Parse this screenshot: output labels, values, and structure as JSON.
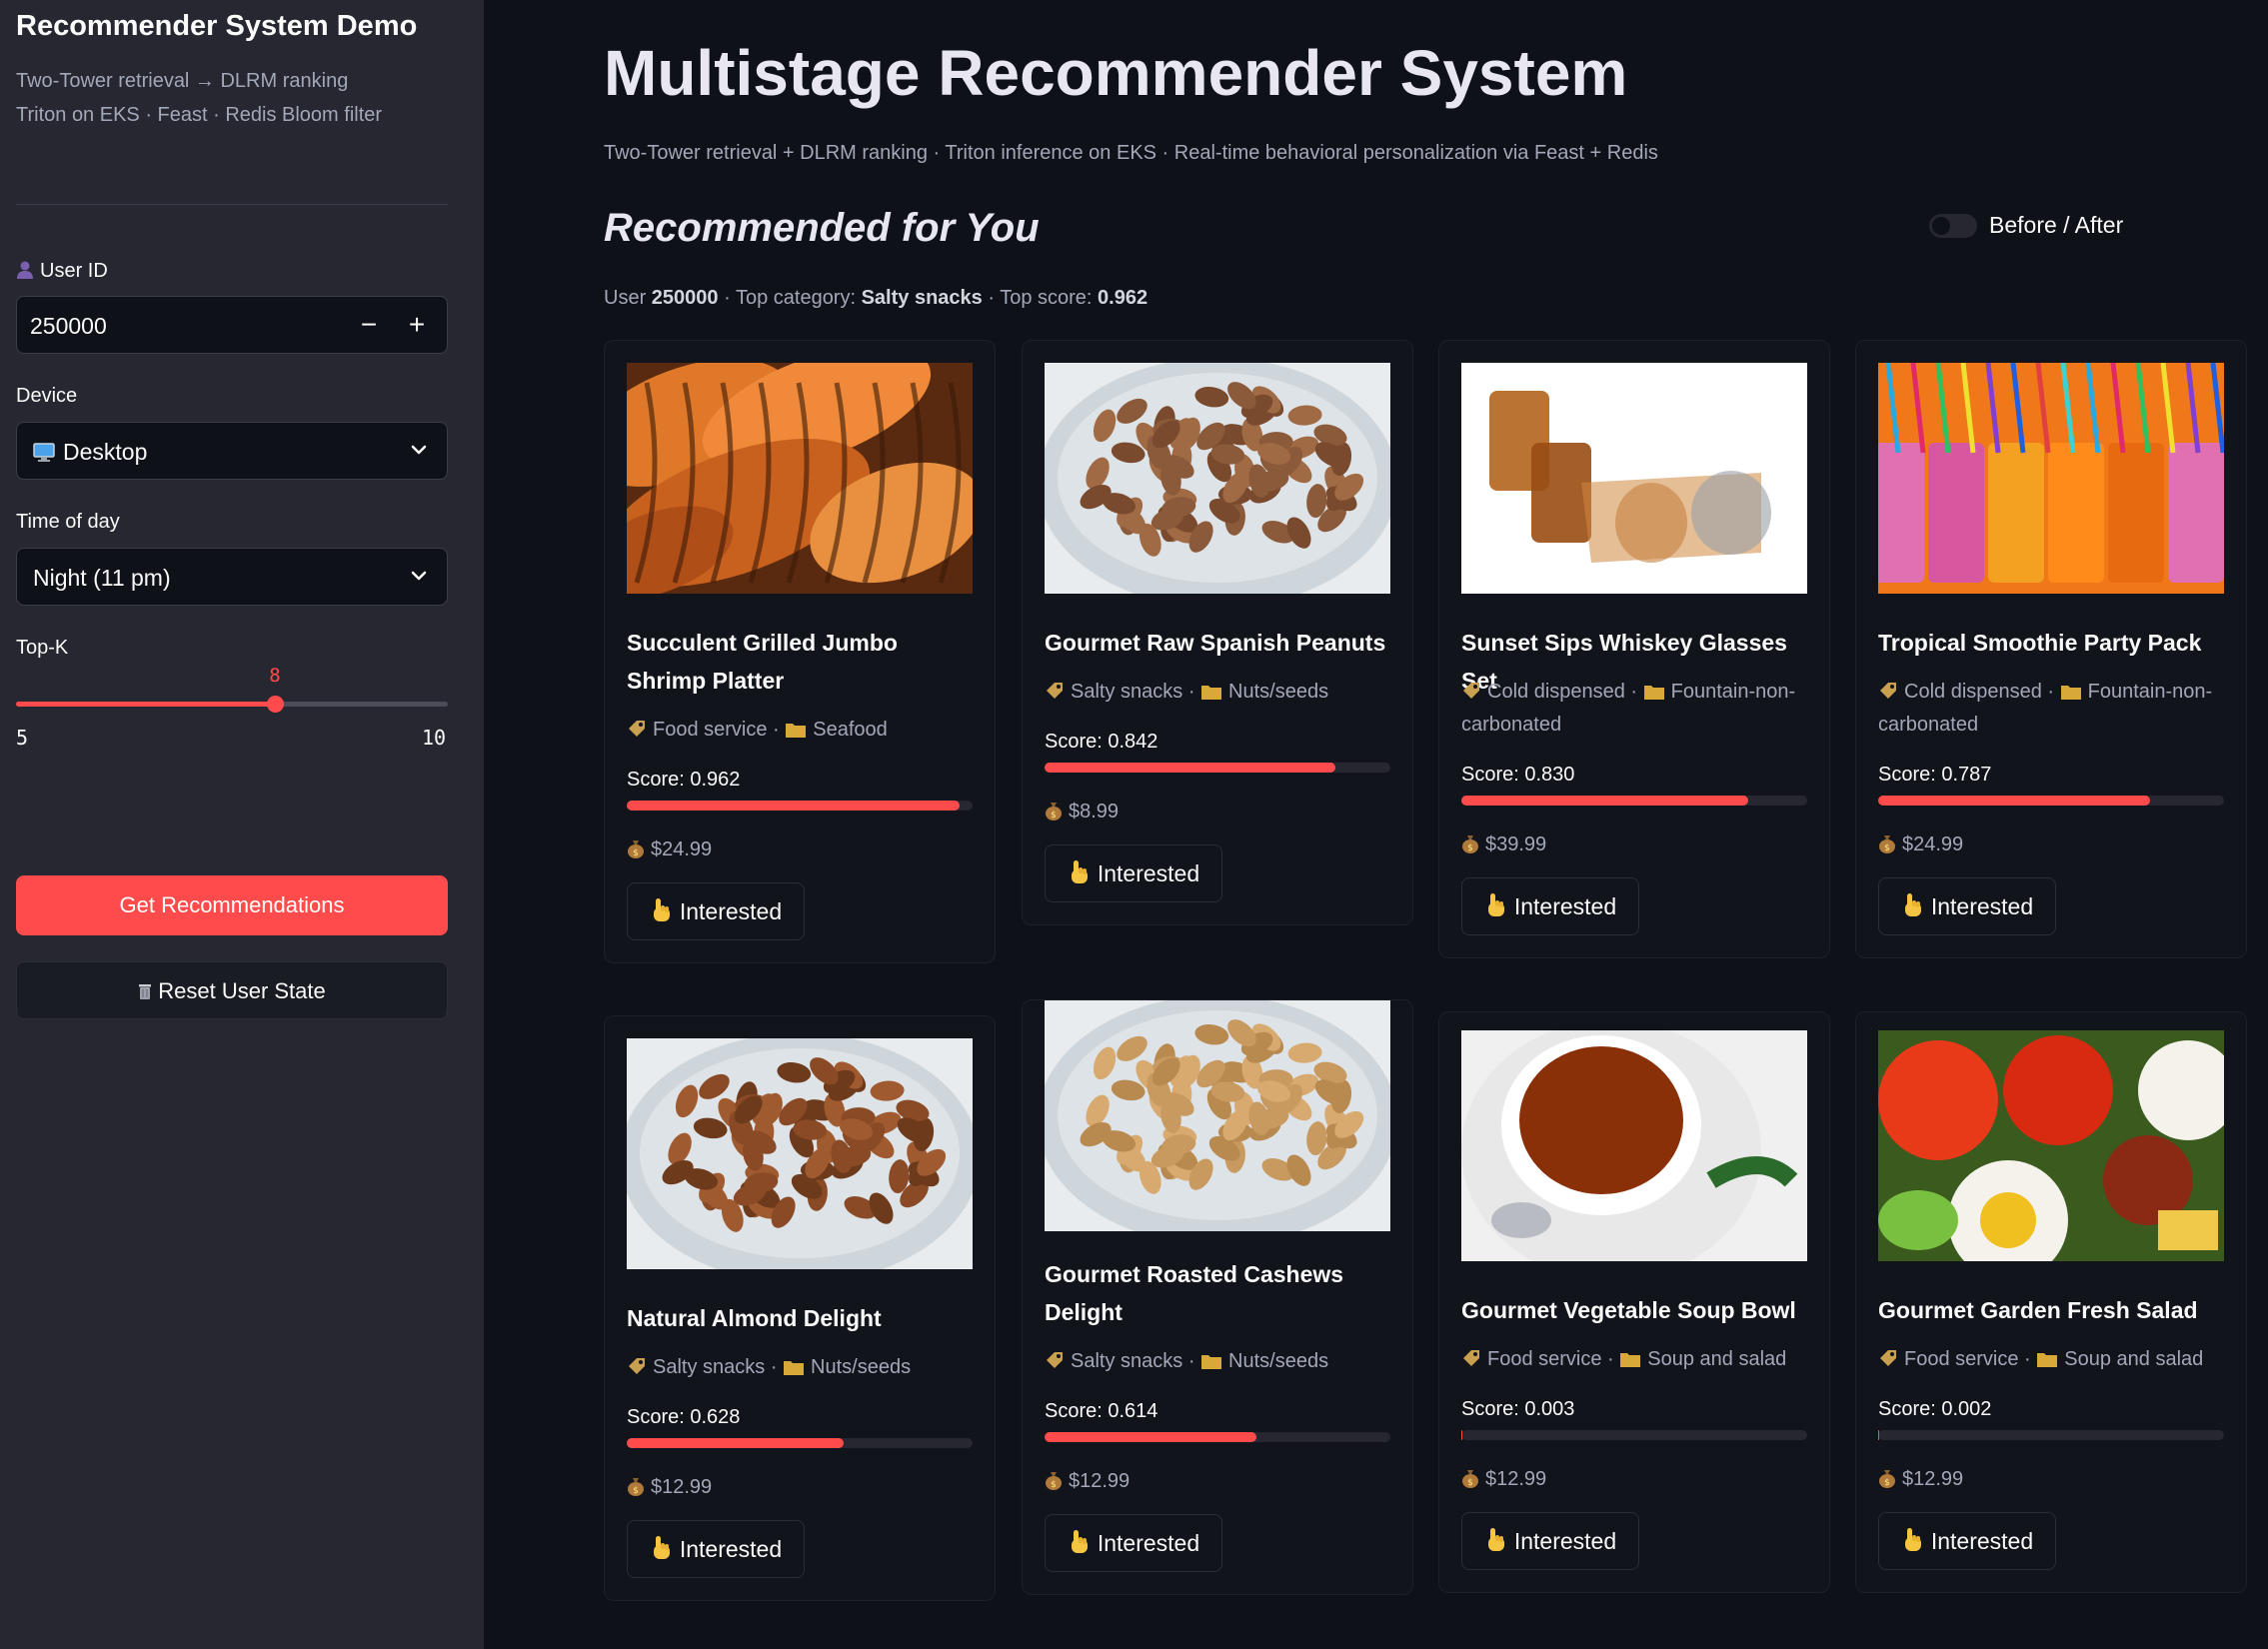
{
  "sidebar": {
    "title": "Recommender System Demo",
    "subtitle_line1": "Two-Tower retrieval → DLRM ranking",
    "subtitle_line2": "Triton on EKS · Feast · Redis Bloom filter",
    "user_id": {
      "label": "User ID",
      "value": "250000",
      "minus": "−",
      "plus": "+"
    },
    "device": {
      "label": "Device",
      "value": "Desktop"
    },
    "time_of_day": {
      "label": "Time of day",
      "value": "Night (11 pm)"
    },
    "top_k": {
      "label": "Top-K",
      "value": "8",
      "min": "5",
      "max": "10",
      "fraction": 0.6
    },
    "get_recs_label": "Get Recommendations",
    "reset_label": "Reset User State"
  },
  "main": {
    "title": "Multistage Recommender System",
    "subtitle": "Two-Tower retrieval + DLRM ranking · Triton inference on EKS · Real-time behavioral personalization via Feast + Redis",
    "section_title": "Recommended for You",
    "toggle_label": "Before / After",
    "summary": {
      "user_prefix": "User ",
      "user": "250000",
      "cat_prefix": " · Top category: ",
      "category": "Salty snacks",
      "score_prefix": " · Top score: ",
      "score": "0.962"
    }
  },
  "colors": {
    "accent": "#ff4b4b",
    "background": "#0e1117",
    "sidebar": "#262730"
  },
  "products": [
    {
      "title": "Succulent Grilled Jumbo Shrimp Platter",
      "category": "Food service",
      "subcategory": "Seafood",
      "score_label": "Score: 0.962",
      "score": 0.962,
      "price": "$24.99",
      "button": "Interested",
      "image": "shrimp"
    },
    {
      "title": "Gourmet Raw Spanish Peanuts",
      "category": "Salty snacks",
      "subcategory": "Nuts/seeds",
      "score_label": "Score: 0.842",
      "score": 0.842,
      "price": "$8.99",
      "button": "Interested",
      "image": "peanuts"
    },
    {
      "title": "Sunset Sips Whiskey Glasses Set",
      "category": "Cold dispensed",
      "subcategory": "Fountain-non-carbonated",
      "score_label": "Score: 0.830",
      "score": 0.83,
      "price": "$39.99",
      "button": "Interested",
      "image": "whiskey"
    },
    {
      "title": "Tropical Smoothie Party Pack",
      "category": "Cold dispensed",
      "subcategory": "Fountain-non-carbonated",
      "score_label": "Score: 0.787",
      "score": 0.787,
      "price": "$24.99",
      "button": "Interested",
      "image": "smoothies"
    },
    {
      "title": "Natural Almond Delight",
      "category": "Salty snacks",
      "subcategory": "Nuts/seeds",
      "score_label": "Score: 0.628",
      "score": 0.628,
      "price": "$12.99",
      "button": "Interested",
      "image": "almonds"
    },
    {
      "title": "Gourmet Roasted Cashews Delight",
      "category": "Salty snacks",
      "subcategory": "Nuts/seeds",
      "score_label": "Score: 0.614",
      "score": 0.614,
      "price": "$12.99",
      "button": "Interested",
      "image": "cashews"
    },
    {
      "title": "Gourmet Vegetable Soup Bowl",
      "category": "Food service",
      "subcategory": "Soup and salad",
      "score_label": "Score: 0.003",
      "score": 0.003,
      "price": "$12.99",
      "button": "Interested",
      "image": "soup"
    },
    {
      "title": "Gourmet Garden Fresh Salad",
      "category": "Food service",
      "subcategory": "Soup and salad",
      "score_label": "Score: 0.002",
      "score": 0.002,
      "price": "$12.99",
      "button": "Interested",
      "image": "salad"
    }
  ]
}
